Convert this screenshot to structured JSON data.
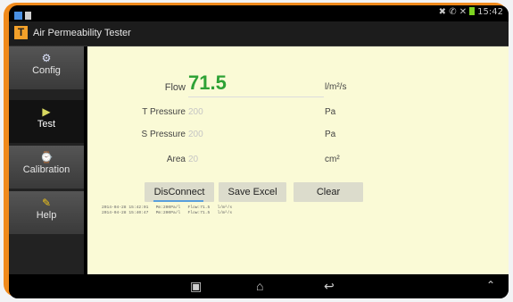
{
  "status": {
    "time": "15:42"
  },
  "app": {
    "title": "Air Permeability Tester",
    "icon_letter": "T"
  },
  "sidebar": {
    "items": [
      {
        "label": "Config",
        "icon": "config-icon"
      },
      {
        "label": "Test",
        "icon": "test-icon"
      },
      {
        "label": "Calibration",
        "icon": "calibration-icon"
      },
      {
        "label": "Help",
        "icon": "help-icon"
      }
    ]
  },
  "fields": {
    "flow": {
      "label": "Flow",
      "value": "71.5",
      "unit": "l/m²/s"
    },
    "t_pressure": {
      "label": "T Pressure",
      "value": "200",
      "unit": "Pa"
    },
    "s_pressure": {
      "label": "S Pressure",
      "value": "200",
      "unit": "Pa"
    },
    "area": {
      "label": "Area",
      "value": "20",
      "unit": "cm²"
    }
  },
  "buttons": {
    "disconnect": "DisConnect",
    "save_excel": "Save Excel",
    "clear": "Clear"
  },
  "log": [
    "2014-04-28 15:42:01   Pm:200Pa/l   Flow:71.5   l/m²/s",
    "2014-04-28 15:40:47   Pm:200Pa/l   Flow:71.5   l/m²/s"
  ],
  "colors": {
    "device_frame": "#f08a1c",
    "main_bg": "#fafad6",
    "flow_value": "#2ea236"
  }
}
